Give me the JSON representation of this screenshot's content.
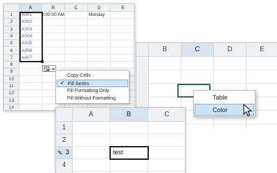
{
  "panel1": {
    "col_headers": [
      "A",
      "B",
      "C",
      "D",
      "E"
    ],
    "row_headers": [
      "1",
      "2",
      "3",
      "4",
      "5",
      "6",
      "7",
      "8",
      "9",
      "10",
      "11",
      "12",
      "13",
      "14"
    ],
    "series": [
      "A001",
      "A002",
      "A003",
      "A004",
      "A005",
      "A006",
      "A007"
    ],
    "b1": "2:00:00 AM",
    "d1": "Monday",
    "menu": {
      "items": [
        "Copy Cells",
        "Fill Series",
        "Fill Formatting Only",
        "Fill Without Formatting"
      ],
      "selected": "Fill Series"
    },
    "icon": "autofill-options-icon"
  },
  "panel2": {
    "col_headers": [
      "B",
      "C",
      "D",
      "E"
    ],
    "selected_col": "C",
    "menu": {
      "items": [
        "Table",
        "Color"
      ],
      "highlighted": "Color"
    }
  },
  "panel3": {
    "col_headers": [
      "A",
      "B",
      "C"
    ],
    "row_headers": [
      "1",
      "2",
      "3",
      "4"
    ],
    "edit_row": "3",
    "cell_b3": "test"
  },
  "colors": {
    "header_bg": "#eef0f2",
    "header_selected": "#d6e4f0",
    "menu_highlight": "#cce4f7",
    "series_text": "#4a6b8a",
    "green_select": "#217346"
  }
}
